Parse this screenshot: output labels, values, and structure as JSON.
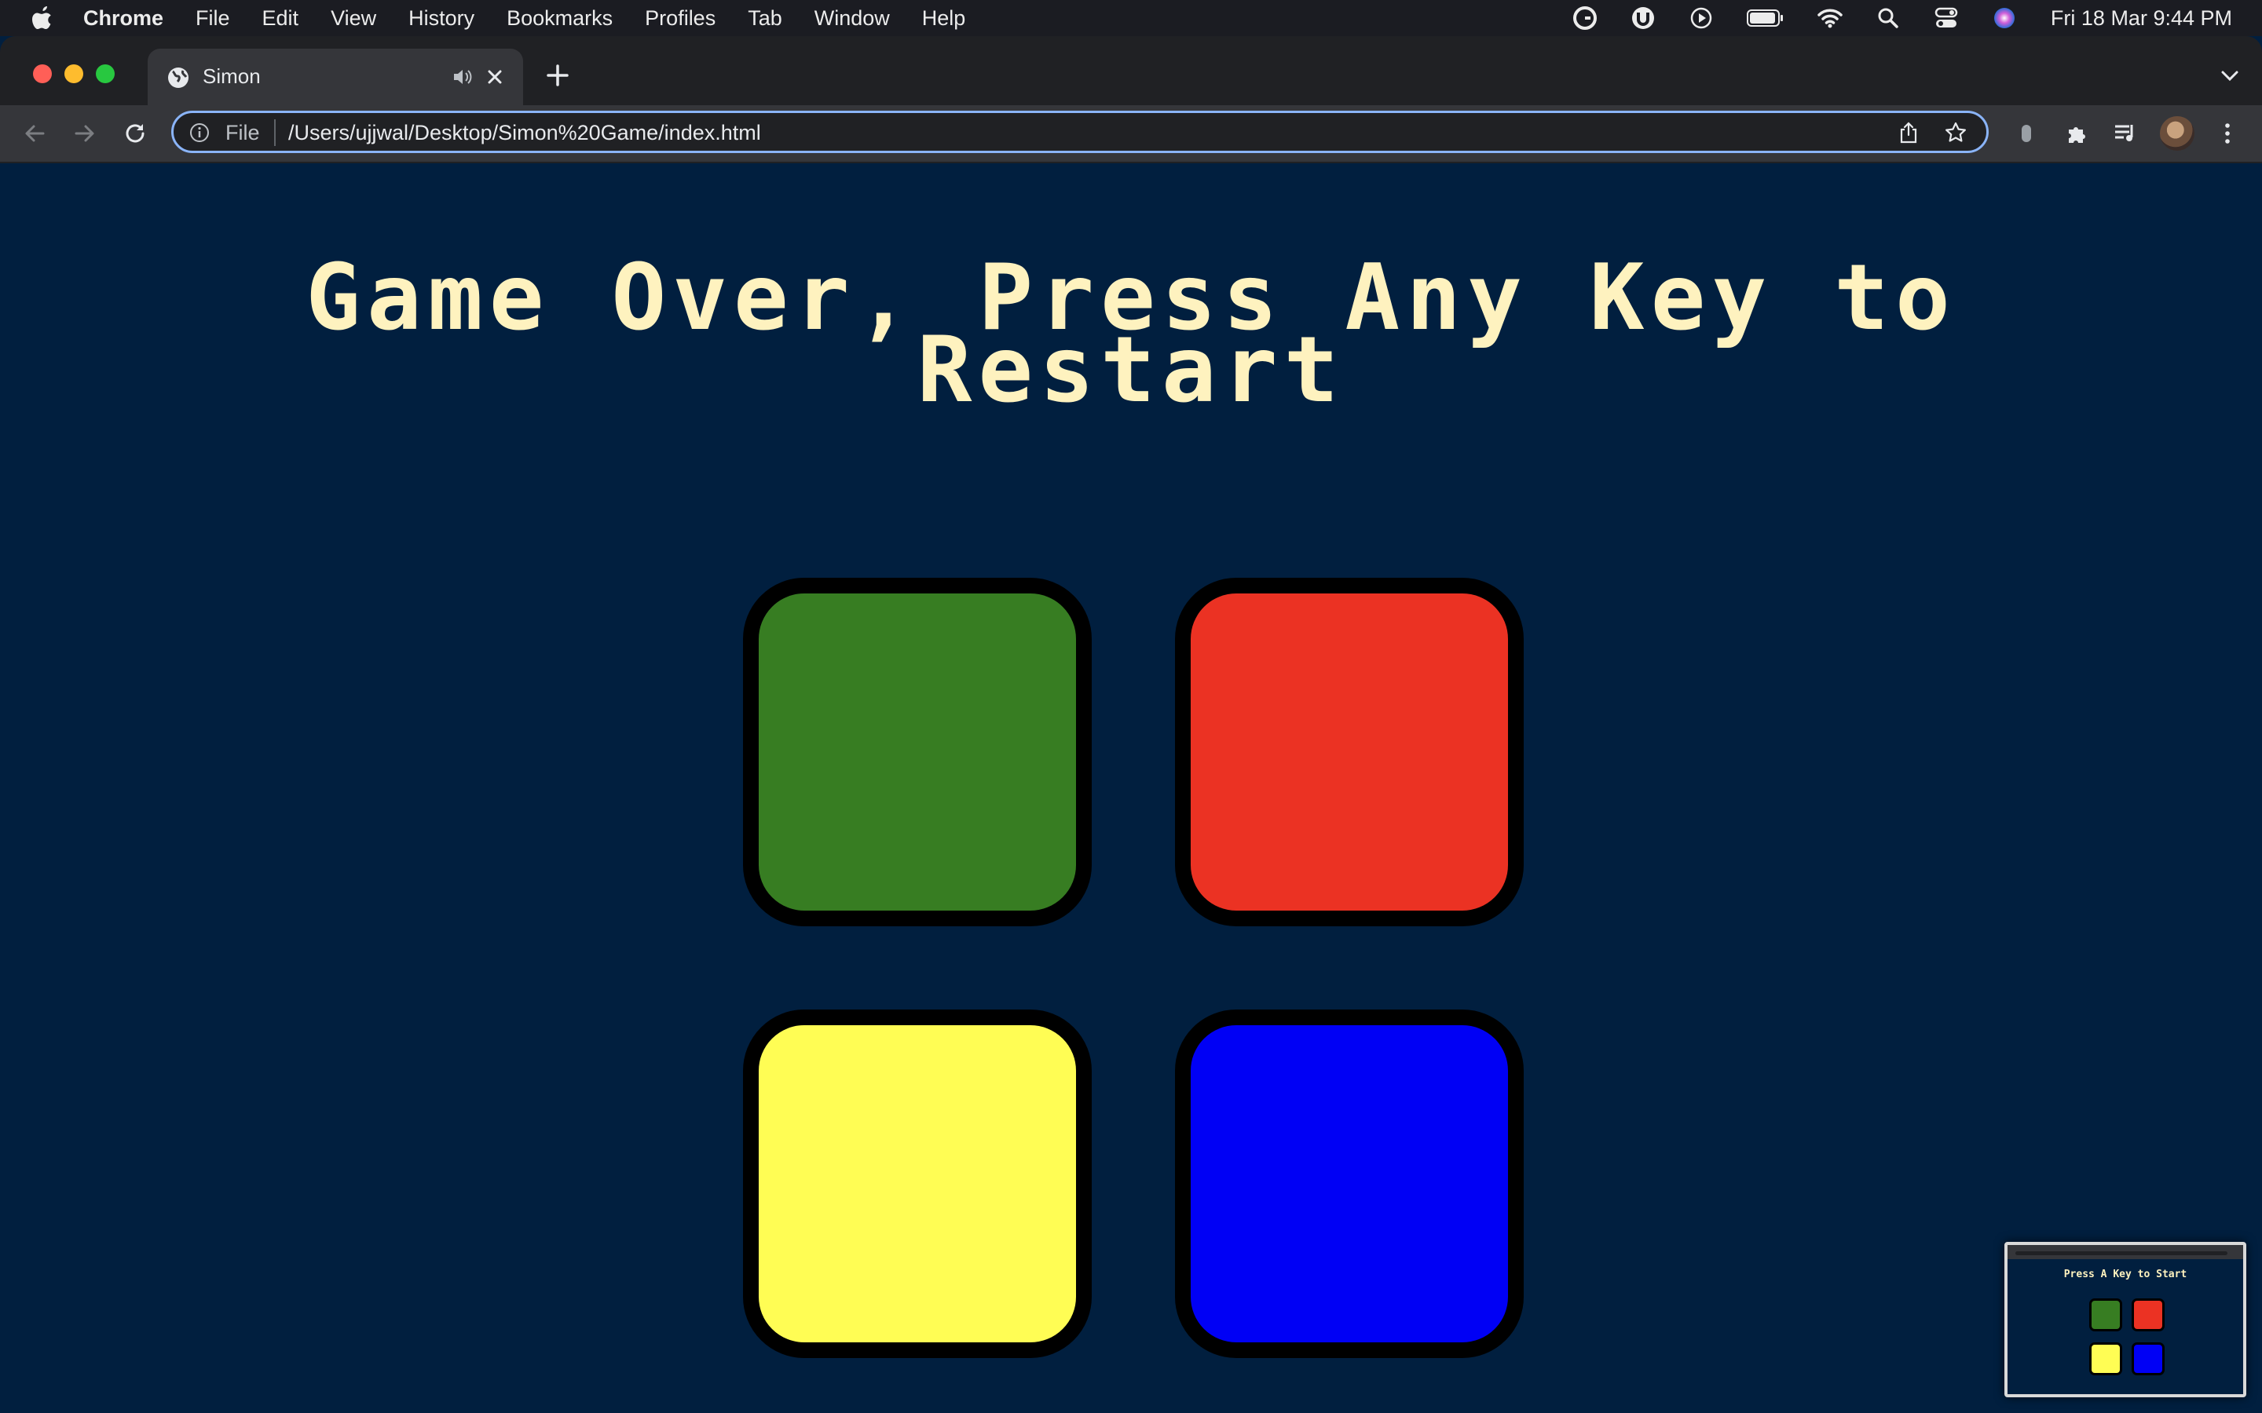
{
  "menubar": {
    "app_name": "Chrome",
    "items": [
      "File",
      "Edit",
      "View",
      "History",
      "Bookmarks",
      "Profiles",
      "Tab",
      "Window",
      "Help"
    ],
    "clock": "Fri 18 Mar  9:44 PM"
  },
  "browser": {
    "tab_title": "Simon",
    "address_scheme": "File",
    "address_url": "/Users/ujjwal/Desktop/Simon%20Game/index.html"
  },
  "page": {
    "title": "Game Over, Press Any Key to Restart",
    "background_color": "#011f3f",
    "title_color": "#fef2bf",
    "buttons": [
      {
        "id": "green",
        "color": "#377d22"
      },
      {
        "id": "red",
        "color": "#eb3223"
      },
      {
        "id": "yellow",
        "color": "#fffd54"
      },
      {
        "id": "blue",
        "color": "#0000f5"
      }
    ]
  },
  "thumbnail": {
    "title": "Press A Key to Start"
  },
  "icons": [
    "apple-icon",
    "grammarly-icon",
    "torrent-icon",
    "play-icon",
    "battery-icon",
    "wifi-icon",
    "spotlight-icon",
    "control-center-icon",
    "siri-icon",
    "globe-icon",
    "speaker-icon",
    "close-icon",
    "plus-icon",
    "chevron-down-icon",
    "back-icon",
    "forward-icon",
    "reload-icon",
    "info-icon",
    "share-icon",
    "star-icon",
    "extension-icon",
    "puzzle-icon",
    "media-icon",
    "kebab-icon"
  ]
}
